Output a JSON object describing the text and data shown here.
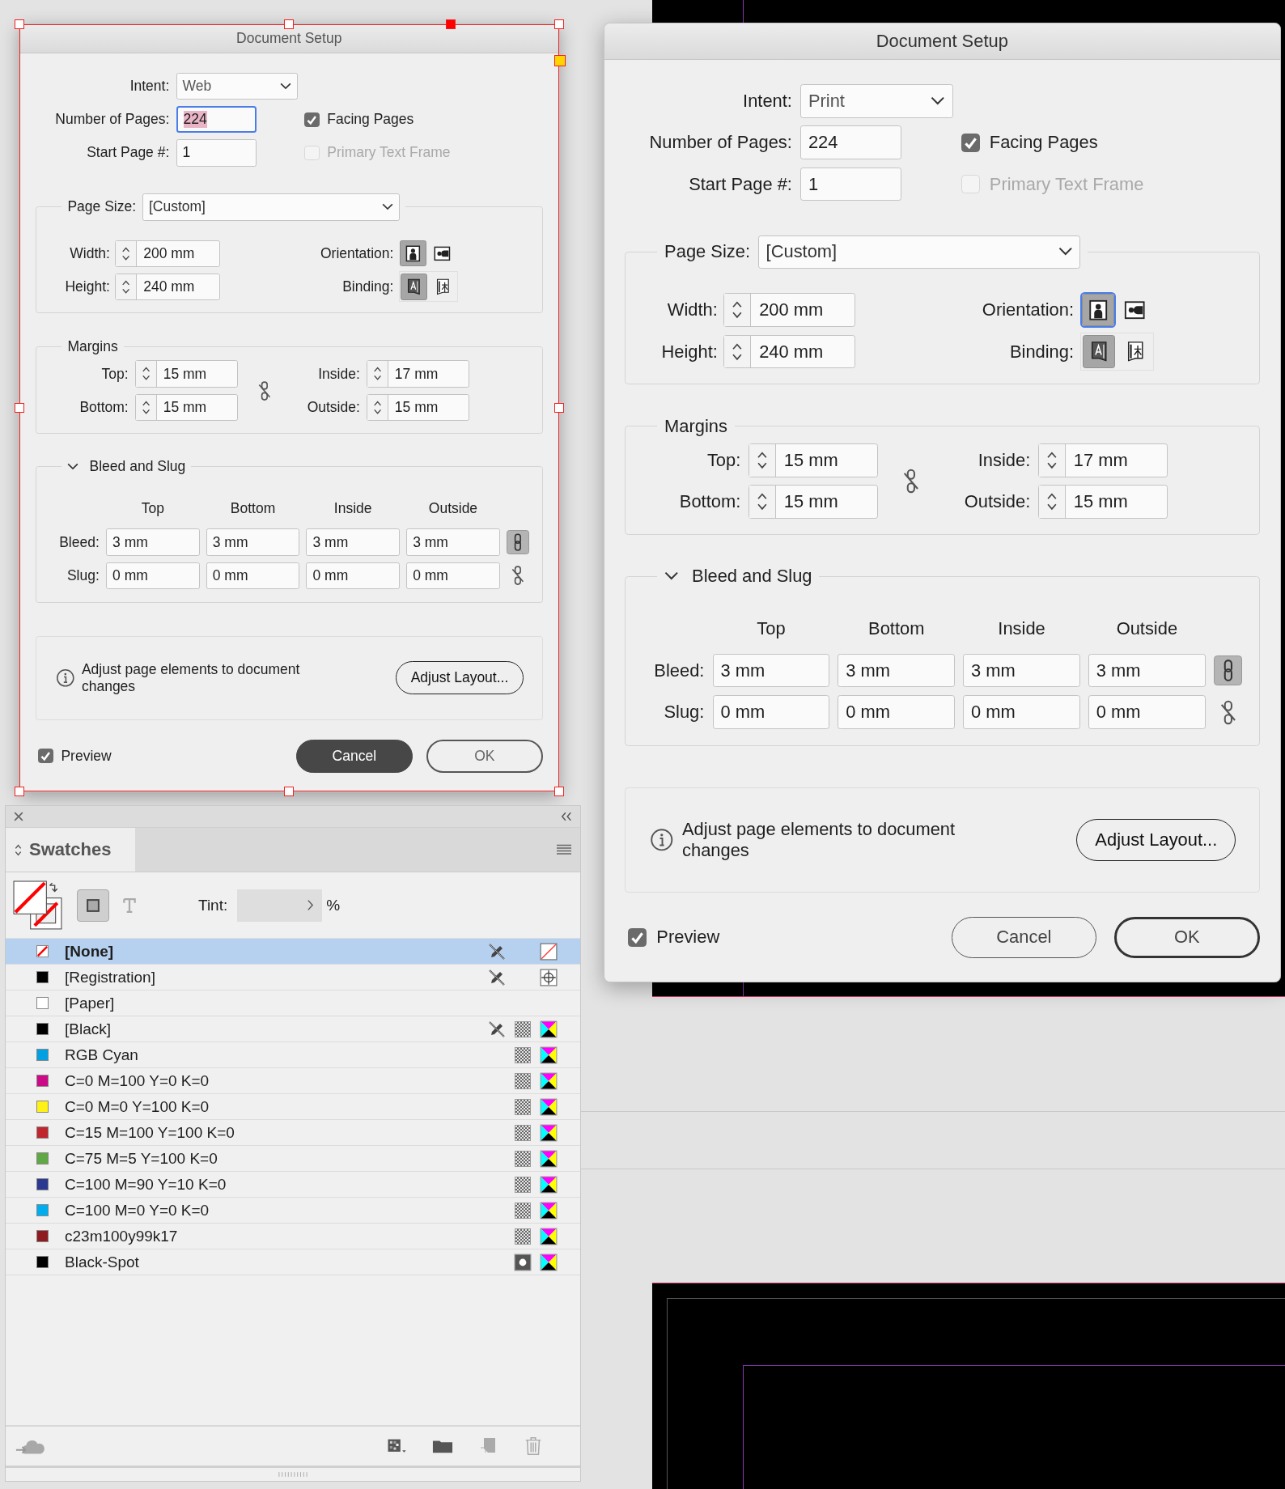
{
  "dialogs": [
    {
      "title": "Document Setup",
      "frame_selected": true,
      "intent": {
        "label": "Intent:",
        "value": "Web"
      },
      "pages": {
        "label": "Number of Pages:",
        "value": "224",
        "focused": true
      },
      "start_page": {
        "label": "Start Page #:",
        "value": "1"
      },
      "facing_pages": {
        "label": "Facing Pages",
        "checked": true,
        "disabled": false
      },
      "primary_text_frame": {
        "label": "Primary Text Frame",
        "checked": false,
        "disabled": true
      },
      "page_size": {
        "label": "Page Size:",
        "value": "[Custom]"
      },
      "width": {
        "label": "Width:",
        "value": "200 mm"
      },
      "height": {
        "label": "Height:",
        "value": "240 mm"
      },
      "orientation": {
        "label": "Orientation:",
        "focused": false,
        "options": [
          {
            "kind": "portrait",
            "selected": true
          },
          {
            "kind": "landscape",
            "selected": false
          }
        ]
      },
      "binding": {
        "label": "Binding:",
        "options": [
          {
            "kind": "left-to-right",
            "selected": true
          },
          {
            "kind": "right-to-left",
            "selected": false
          }
        ]
      },
      "margins": {
        "title": "Margins",
        "linked": false,
        "fields": [
          {
            "label": "Top:",
            "value": "15 mm"
          },
          {
            "label": "Inside:",
            "value": "17 mm"
          },
          {
            "label": "Bottom:",
            "value": "15 mm"
          },
          {
            "label": "Outside:",
            "value": "15 mm"
          }
        ]
      },
      "bleed_slug": {
        "title": "Bleed and Slug",
        "expanded": true,
        "columns": [
          "Top",
          "Bottom",
          "Inside",
          "Outside"
        ],
        "rows": [
          {
            "label": "Bleed:",
            "values": [
              "3 mm",
              "3 mm",
              "3 mm",
              "3 mm"
            ],
            "linked": true
          },
          {
            "label": "Slug:",
            "values": [
              "0 mm",
              "0 mm",
              "0 mm",
              "0 mm"
            ],
            "linked": false
          }
        ]
      },
      "info": {
        "text": "Adjust page elements to document changes",
        "button": "Adjust Layout..."
      },
      "preview": {
        "label": "Preview",
        "checked": true
      },
      "buttons": [
        {
          "label": "Cancel",
          "kind": "filled"
        },
        {
          "label": "OK",
          "kind": "dimmed"
        }
      ]
    },
    {
      "title": "Document Setup",
      "frame_selected": false,
      "intent": {
        "label": "Intent:",
        "value": "Print"
      },
      "pages": {
        "label": "Number of Pages:",
        "value": "224",
        "focused": false
      },
      "start_page": {
        "label": "Start Page #:",
        "value": "1"
      },
      "facing_pages": {
        "label": "Facing Pages",
        "checked": true,
        "disabled": false
      },
      "primary_text_frame": {
        "label": "Primary Text Frame",
        "checked": false,
        "disabled": true
      },
      "page_size": {
        "label": "Page Size:",
        "value": "[Custom]"
      },
      "width": {
        "label": "Width:",
        "value": "200 mm"
      },
      "height": {
        "label": "Height:",
        "value": "240 mm"
      },
      "orientation": {
        "label": "Orientation:",
        "focused": true,
        "options": [
          {
            "kind": "portrait",
            "selected": true
          },
          {
            "kind": "landscape",
            "selected": false
          }
        ]
      },
      "binding": {
        "label": "Binding:",
        "options": [
          {
            "kind": "left-to-right",
            "selected": true
          },
          {
            "kind": "right-to-left",
            "selected": false
          }
        ]
      },
      "margins": {
        "title": "Margins",
        "linked": false,
        "fields": [
          {
            "label": "Top:",
            "value": "15 mm"
          },
          {
            "label": "Inside:",
            "value": "17 mm"
          },
          {
            "label": "Bottom:",
            "value": "15 mm"
          },
          {
            "label": "Outside:",
            "value": "15 mm"
          }
        ]
      },
      "bleed_slug": {
        "title": "Bleed and Slug",
        "expanded": true,
        "columns": [
          "Top",
          "Bottom",
          "Inside",
          "Outside"
        ],
        "rows": [
          {
            "label": "Bleed:",
            "values": [
              "3 mm",
              "3 mm",
              "3 mm",
              "3 mm"
            ],
            "linked": true
          },
          {
            "label": "Slug:",
            "values": [
              "0 mm",
              "0 mm",
              "0 mm",
              "0 mm"
            ],
            "linked": false
          }
        ]
      },
      "info": {
        "text": "Adjust page elements to document changes",
        "button": "Adjust Layout..."
      },
      "preview": {
        "label": "Preview",
        "checked": true
      },
      "buttons": [
        {
          "label": "Cancel",
          "kind": "outline"
        },
        {
          "label": "OK",
          "kind": "default"
        }
      ]
    }
  ],
  "swatches_panel": {
    "tab": "Swatches",
    "tint_label": "Tint:",
    "tint_unit": "%",
    "rows": [
      {
        "name": "[None]",
        "kind": "none",
        "selected": true,
        "locked": true
      },
      {
        "name": "[Registration]",
        "kind": "registration",
        "color": "#000000",
        "selected": false,
        "locked": true
      },
      {
        "name": "[Paper]",
        "kind": "paper",
        "color": "#ffffff",
        "selected": false,
        "locked": false
      },
      {
        "name": "[Black]",
        "kind": "process",
        "color": "#000000",
        "selected": false,
        "locked": true
      },
      {
        "name": "RGB Cyan",
        "kind": "process",
        "color": "#00a0e3",
        "selected": false,
        "locked": false
      },
      {
        "name": "C=0 M=100 Y=0 K=0",
        "kind": "process",
        "color": "#cc0a87",
        "selected": false,
        "locked": false
      },
      {
        "name": "C=0 M=0 Y=100 K=0",
        "kind": "process",
        "color": "#fff214",
        "selected": false,
        "locked": false
      },
      {
        "name": "C=15 M=100 Y=100 K=0",
        "kind": "process",
        "color": "#c0262d",
        "selected": false,
        "locked": false
      },
      {
        "name": "C=75 M=5 Y=100 K=0",
        "kind": "process",
        "color": "#5fa845",
        "selected": false,
        "locked": false
      },
      {
        "name": "C=100 M=90 Y=10 K=0",
        "kind": "process",
        "color": "#2b3990",
        "selected": false,
        "locked": false
      },
      {
        "name": "C=100 M=0 Y=0 K=0",
        "kind": "process",
        "color": "#00aeef",
        "selected": false,
        "locked": false
      },
      {
        "name": "c23m100y99k17",
        "kind": "process",
        "color": "#8e1b20",
        "selected": false,
        "locked": false
      },
      {
        "name": "Black-Spot",
        "kind": "spot",
        "color": "#000000",
        "selected": false,
        "locked": false
      }
    ]
  }
}
